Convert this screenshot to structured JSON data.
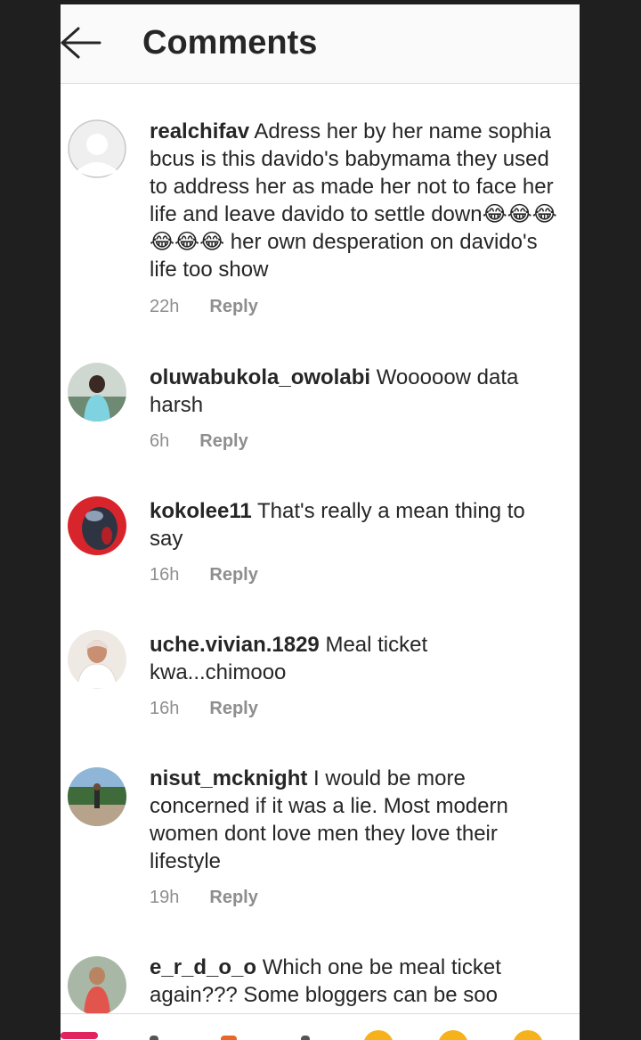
{
  "header": {
    "title": "Comments",
    "back_icon": "arrow-left-icon"
  },
  "comments": [
    {
      "username": "realchifav",
      "text": "Adress her by her name sophia bcus is this davido's babymama they used to address her as made her not to face her life and leave davido to settle down😂😂😂😂😂😂 her own desperation on davido's life too show",
      "time": "22h",
      "reply_label": "Reply"
    },
    {
      "username": "oluwabukola_owolabi",
      "text": "Wooooow data harsh",
      "time": "6h",
      "reply_label": "Reply"
    },
    {
      "username": "kokolee11",
      "text": "That's really a mean thing to say",
      "time": "16h",
      "reply_label": "Reply"
    },
    {
      "username": "uche.vivian.1829",
      "text": "Meal ticket kwa...chimooo",
      "time": "16h",
      "reply_label": "Reply"
    },
    {
      "username": "nisut_mcknight",
      "text": "I would be more concerned if it was a lie. Most modern women dont love men they love their lifestyle",
      "time": "19h",
      "reply_label": "Reply"
    },
    {
      "username": "e_r_d_o_o",
      "text": "Which one be meal ticket again??? Some bloggers can be soo stupid",
      "time": "",
      "reply_label": ""
    }
  ]
}
